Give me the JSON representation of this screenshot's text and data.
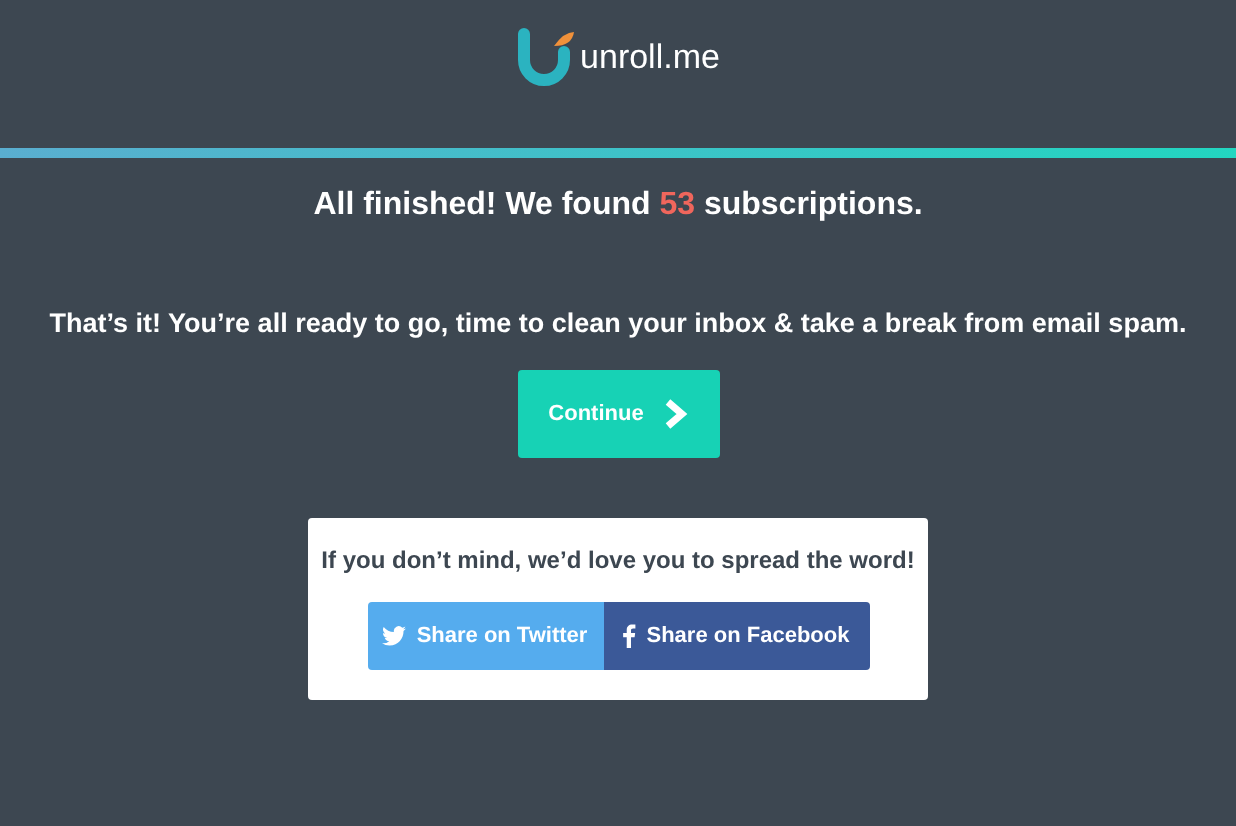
{
  "logo": {
    "text": "unroll.me"
  },
  "progress": {
    "level": 1
  },
  "headline": {
    "before": "All finished! We found ",
    "count": "53",
    "after": " subscriptions."
  },
  "message": "That’s it! You’re all ready to go, time to clean your inbox & take a break from email spam.",
  "continue_button": {
    "label": "Continue"
  },
  "share": {
    "prompt": "If you don’t mind, we’d love you to spread the word!",
    "buttons": [
      {
        "kind": "twitter",
        "label": "Share on Twitter"
      },
      {
        "kind": "facebook",
        "label": "Share on Facebook"
      }
    ]
  }
}
